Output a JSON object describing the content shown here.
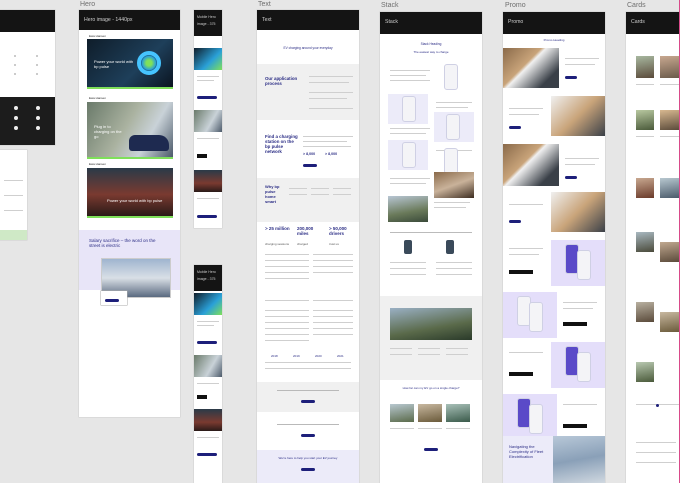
{
  "columns": {
    "hero": {
      "label": "Hero",
      "frame_title": "Hero image - 1440px",
      "section_titles": [
        "Ewa Hansen",
        "Plug in to charging on the go",
        "Power your world with bp pulse",
        "Salary sacrifice – the word on the street is electric"
      ],
      "banner_text": "Power your world with bp pulse",
      "mid_text": "Plug in to charging on the go",
      "bottom_text": "Power your world with bp pulse"
    },
    "hero_mobile_a": {
      "frame_title": "Mobile Hero",
      "frame_subtitle": "image - 375"
    },
    "hero_mobile_b": {
      "frame_title": "Mobile Hero",
      "frame_subtitle": "image - 375"
    },
    "text": {
      "label": "Text",
      "frame_title": "Text",
      "heading_1": "EV charging around your everyday",
      "heading_2": "Our application process",
      "heading_3": "Find a charging station on the bp pulse network",
      "heading_4": "Why bp pulse home smart",
      "stats": [
        {
          "value": "> 25 million",
          "sub": "charging sessions"
        },
        {
          "value": "200,000 miles",
          "sub": "charged"
        },
        {
          "value": "> 50,000 drivers",
          "sub": "trust us"
        }
      ],
      "years": [
        "2018",
        "2019",
        "2020",
        "2021"
      ],
      "footer_heading": "We're here to help you start your EV journey"
    },
    "stack": {
      "label": "Stack",
      "frame_title": "Stack",
      "heading": "Stack Heading",
      "sub_heading": "The easiest way to charge",
      "bottom_heading": "How far can my EV go on a single charge?"
    },
    "promo": {
      "label": "Promo",
      "frame_title": "Promo",
      "heading": "Promo Heading",
      "final_text": "Navigating the Complexity of Fleet Electrification"
    },
    "cards": {
      "label": "Cards",
      "frame_title": "Cards"
    }
  },
  "colors": {
    "canvas": "#e6e6e6",
    "frame_header": "#141414",
    "accent_navy": "#1d1f7a",
    "accent_green": "#7fe05a",
    "lavender": "#ecebf9"
  }
}
